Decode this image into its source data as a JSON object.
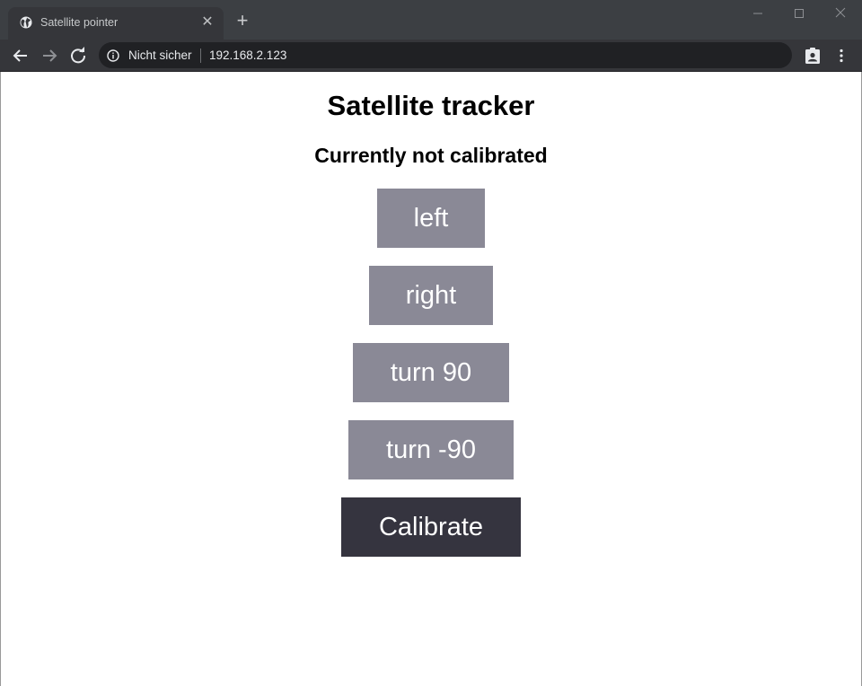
{
  "browser": {
    "tab_title": "Satellite pointer",
    "tab_icon": "globe-icon",
    "security_label": "Nicht sicher",
    "url": "192.168.2.123"
  },
  "page": {
    "title": "Satellite tracker",
    "status": "Currently not calibrated",
    "buttons": [
      {
        "label": "left"
      },
      {
        "label": "right"
      },
      {
        "label": "turn 90"
      },
      {
        "label": "turn -90"
      },
      {
        "label": "Calibrate"
      }
    ]
  },
  "colors": {
    "button": "#8a8996",
    "calibrate_button": "#35343f"
  }
}
